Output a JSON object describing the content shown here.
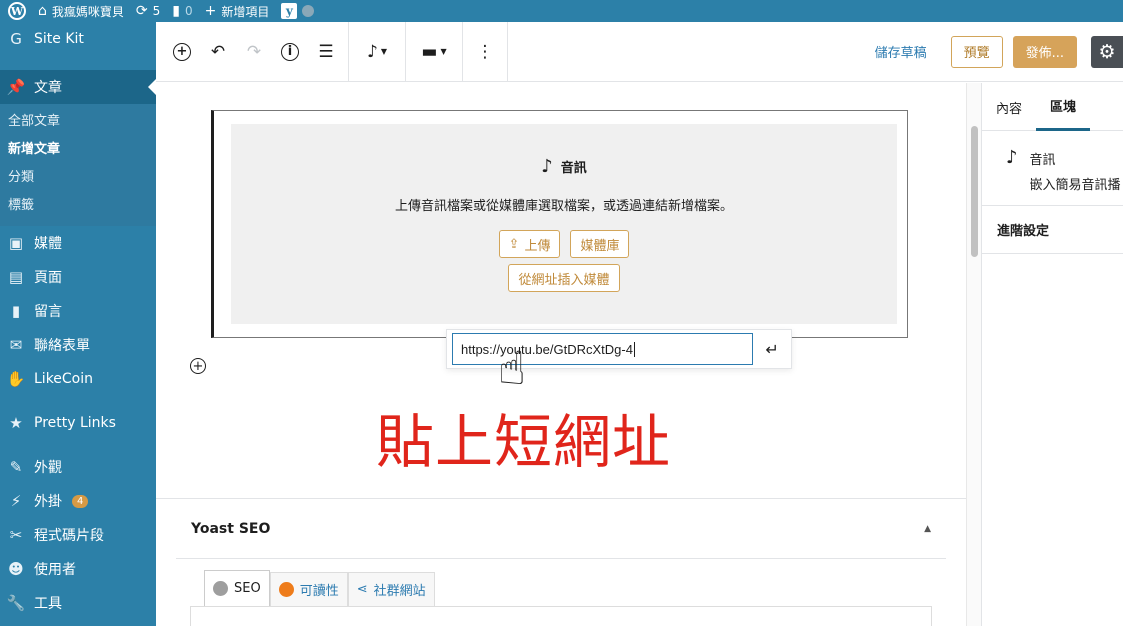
{
  "admin_bar": {
    "site_name": "我瘋媽咪寶貝",
    "updates_count": "5",
    "comments_count": "0",
    "new_label": "新增項目"
  },
  "sidebar": {
    "site_kit": "Site Kit",
    "posts": "文章",
    "posts_submenu": [
      "全部文章",
      "新增文章",
      "分類",
      "標籤"
    ],
    "media": "媒體",
    "pages": "頁面",
    "comments": "留言",
    "contact": "聯絡表單",
    "likecoin": "LikeCoin",
    "pretty_links": "Pretty Links",
    "appearance": "外觀",
    "plugins": "外掛",
    "plugins_badge": "4",
    "snippets": "程式碼片段",
    "users": "使用者",
    "tools": "工具"
  },
  "toolbar": {
    "save_draft": "儲存草稿",
    "preview": "預覽",
    "publish": "發佈..."
  },
  "audio_block": {
    "title": "音訊",
    "instructions": "上傳音訊檔案或從媒體庫選取檔案，或透過連結新增檔案。",
    "upload": "上傳",
    "media_library": "媒體庫",
    "insert_from_url": "從網址插入媒體",
    "url_value": "https://youtu.be/GtDRcXtDg-4"
  },
  "annotation": {
    "text": "貼上短網址"
  },
  "yoast": {
    "title": "Yoast SEO",
    "tabs": [
      "SEO",
      "可讀性",
      "社群網站"
    ]
  },
  "settings_sidebar": {
    "tabs": [
      "內容",
      "區塊"
    ],
    "block_name": "音訊",
    "block_desc": "嵌入簡易音訊播",
    "advanced": "進階設定"
  },
  "colors": {
    "admin_accent": "#2c80a8",
    "admin_current": "#1c6689",
    "button_gold": "#d6a35a",
    "annotation_red": "#e0251b",
    "link_blue": "#2c7bb0"
  }
}
